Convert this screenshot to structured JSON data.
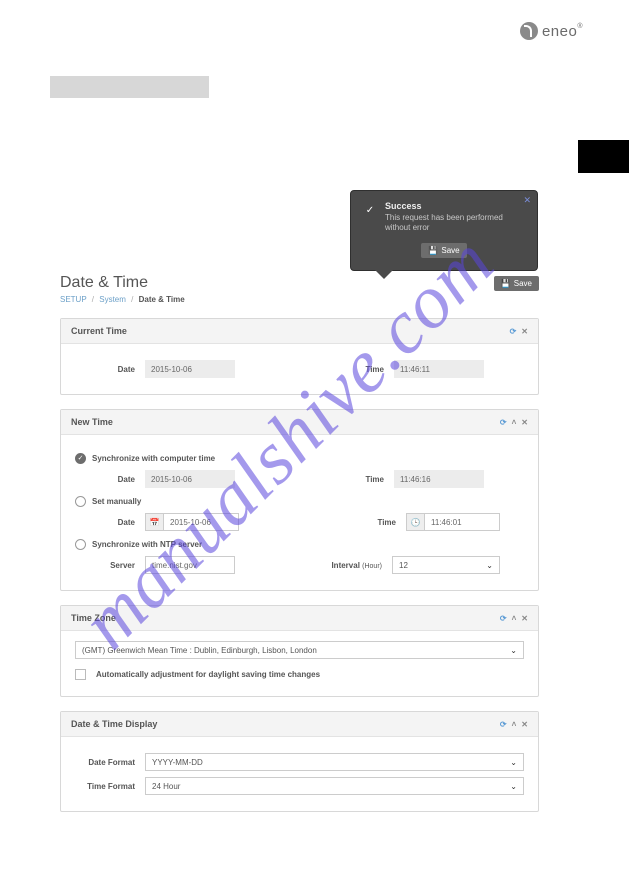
{
  "brand": {
    "name": "eneo"
  },
  "watermark": "manualshive.com",
  "page": {
    "title": "Date & Time",
    "breadcrumb": {
      "a": "SETUP",
      "b": "System",
      "c": "Date & Time"
    },
    "save_label": "Save"
  },
  "toast": {
    "title": "Success",
    "message": "This request has been performed without error",
    "save_label": "Save"
  },
  "panels": {
    "current": {
      "title": "Current Time",
      "date_label": "Date",
      "date_value": "2015-10-06",
      "time_label": "Time",
      "time_value": "11:46:11"
    },
    "new": {
      "title": "New Time",
      "opt_sync_computer": "Synchronize with computer time",
      "date_label": "Date",
      "date_value": "2015-10-06",
      "time_label": "Time",
      "time_value": "11:46:16",
      "opt_manual": "Set manually",
      "manual_date_label": "Date",
      "manual_date_value": "2015-10-06",
      "manual_time_label": "Time",
      "manual_time_value": "11:46:01",
      "opt_ntp": "Synchronize with NTP server",
      "server_label": "Server",
      "server_value": "time.nist.gov",
      "interval_label": "Interval",
      "interval_unit": "(Hour)",
      "interval_value": "12"
    },
    "tz": {
      "title": "Time Zone",
      "value": "(GMT) Greenwich Mean Time : Dublin, Edinburgh, Lisbon, London",
      "dst_label": "Automatically adjustment for daylight saving time changes"
    },
    "display": {
      "title": "Date & Time Display",
      "date_fmt_label": "Date Format",
      "date_fmt_value": "YYYY-MM-DD",
      "time_fmt_label": "Time Format",
      "time_fmt_value": "24 Hour"
    }
  }
}
